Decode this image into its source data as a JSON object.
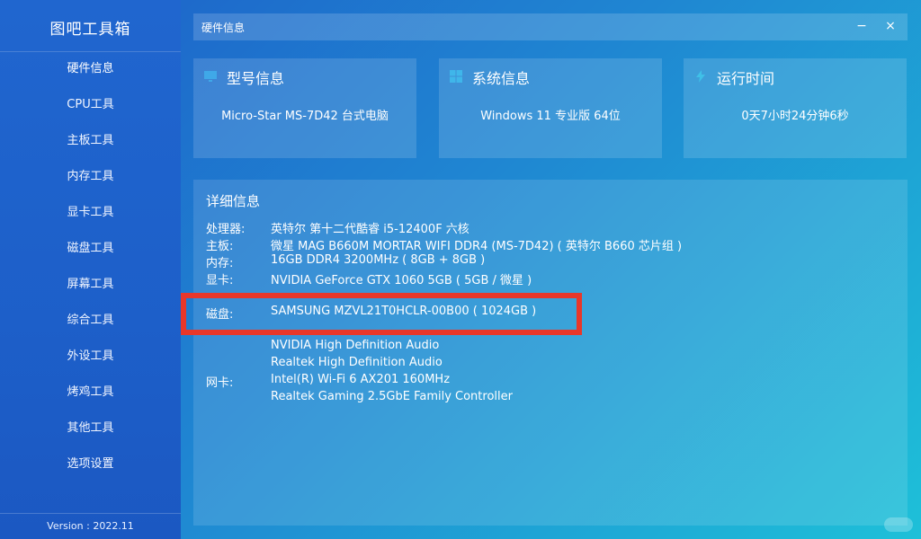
{
  "app": {
    "title": "图吧工具箱",
    "version": "Version : 2022.11"
  },
  "sidebar": {
    "items": [
      {
        "label": "硬件信息"
      },
      {
        "label": "CPU工具"
      },
      {
        "label": "主板工具"
      },
      {
        "label": "内存工具"
      },
      {
        "label": "显卡工具"
      },
      {
        "label": "磁盘工具"
      },
      {
        "label": "屏幕工具"
      },
      {
        "label": "综合工具"
      },
      {
        "label": "外设工具"
      },
      {
        "label": "烤鸡工具"
      },
      {
        "label": "其他工具"
      },
      {
        "label": "选项设置"
      }
    ]
  },
  "titlebar": {
    "text": "硬件信息",
    "minimize_glyph": "−",
    "close_glyph": "×"
  },
  "cards": {
    "model": {
      "title": "型号信息",
      "value": "Micro-Star  MS-7D42 台式电脑",
      "icon": "monitor-icon"
    },
    "system": {
      "title": "系统信息",
      "value": "Windows 11 专业版 64位",
      "icon": "windows-icon"
    },
    "uptime": {
      "title": "运行时间",
      "value": "0天7小时24分钟6秒",
      "icon": "lightning-icon"
    }
  },
  "detail": {
    "title": "详细信息",
    "rows": {
      "cpu": {
        "label": "处理器:",
        "value": "英特尔 第十二代酷睿 i5-12400F 六核"
      },
      "board": {
        "label": "主板:",
        "value": "微星 MAG B660M MORTAR WIFI DDR4 (MS-7D42) ( 英特尔 B660 芯片组 )"
      },
      "memory": {
        "label": "内存:",
        "value": "16GB DDR4 3200MHz ( 8GB + 8GB )"
      },
      "gpu": {
        "label": "显卡:",
        "value": "NVIDIA GeForce GTX 1060 5GB ( 5GB / 微星 )"
      },
      "disk": {
        "label": "磁盘:",
        "value": "SAMSUNG MZVL21T0HCLR-00B00 ( 1024GB )"
      },
      "audio1": {
        "value": "NVIDIA High Definition Audio"
      },
      "audio2": {
        "value": "Realtek High Definition Audio"
      },
      "nic": {
        "label": "网卡:",
        "value": "Intel(R) Wi-Fi 6 AX201 160MHz"
      },
      "nic2": {
        "value": "Realtek Gaming 2.5GbE Family Controller"
      }
    }
  },
  "colors": {
    "highlight": "#e8372a",
    "sidebar": "#1f62cc",
    "gradient_end": "#1ec0d8"
  }
}
